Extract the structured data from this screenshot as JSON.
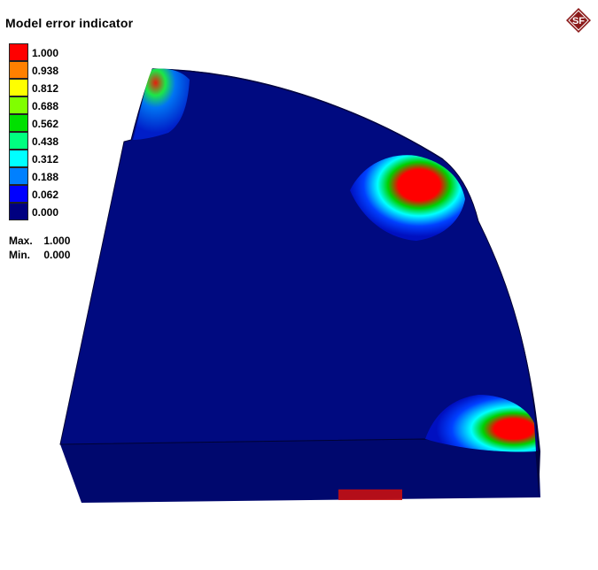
{
  "title": "Model error indicator",
  "logo": {
    "icon": "sf-diamond-logo-icon",
    "text": "SF",
    "color": "#8b1a1a"
  },
  "legend": {
    "entries": [
      {
        "value": "1.000",
        "color": "#ff0000"
      },
      {
        "value": "0.938",
        "color": "#ff8000"
      },
      {
        "value": "0.812",
        "color": "#ffff00"
      },
      {
        "value": "0.688",
        "color": "#80ff00"
      },
      {
        "value": "0.562",
        "color": "#00e000"
      },
      {
        "value": "0.438",
        "color": "#00ff80"
      },
      {
        "value": "0.312",
        "color": "#00ffff"
      },
      {
        "value": "0.188",
        "color": "#0080ff"
      },
      {
        "value": "0.062",
        "color": "#0000ff"
      },
      {
        "value": "0.000",
        "color": "#000080"
      }
    ]
  },
  "stats": {
    "max_label": "Max.",
    "max_value": "1.000",
    "min_label": "Min.",
    "min_value": "0.000"
  },
  "colors": {
    "base": "#000a80",
    "side": "#000670",
    "edge": "#000333"
  }
}
